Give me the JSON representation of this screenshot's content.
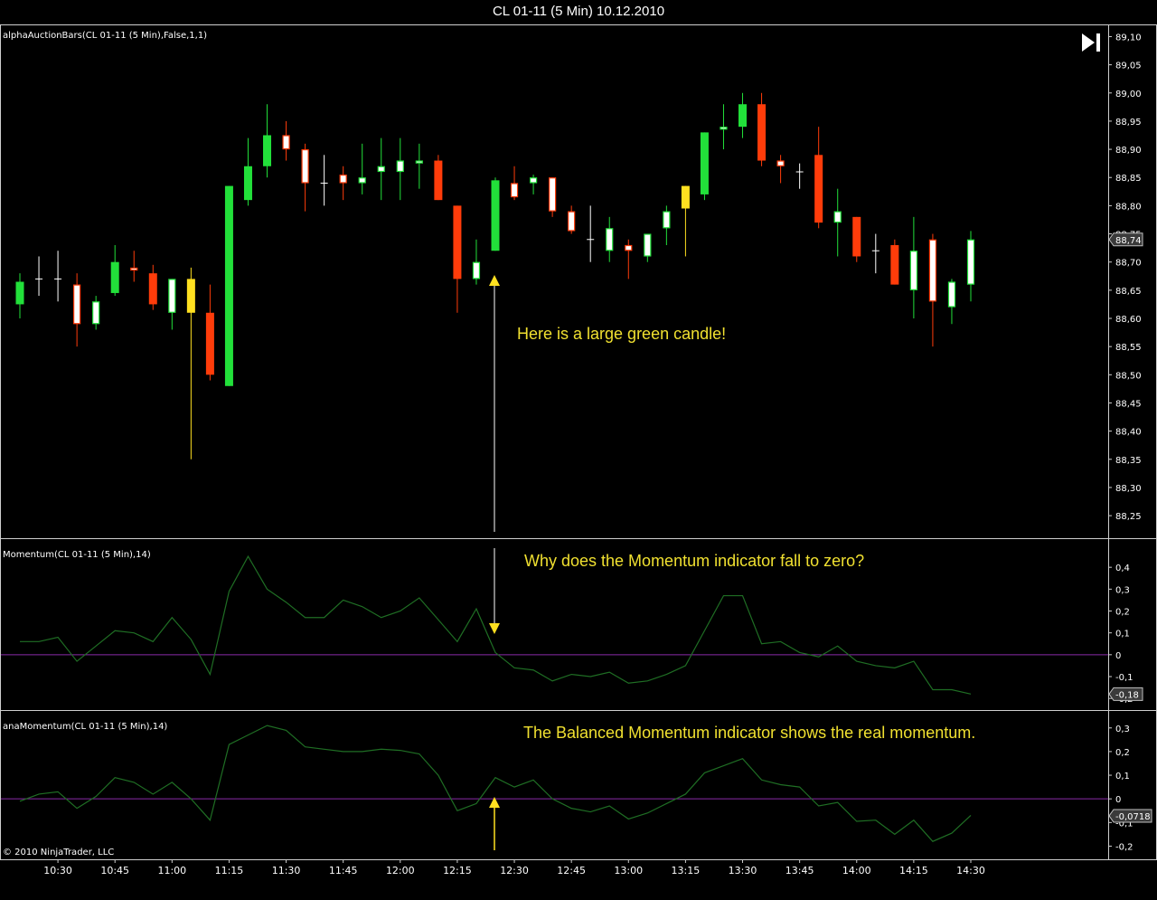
{
  "window": {
    "title": "CL 01-11 (5 Min)  10.12.2010"
  },
  "copyright": "© 2010 NinjaTrader, LLC",
  "colors": {
    "background": "#000000",
    "bull": "#22e03a",
    "bear": "#ff3c0a",
    "neutral_body": "#ffffff",
    "neutral_wick": "#ffffff",
    "yellow": "#ffe020",
    "indicator_line": "#1f6e24",
    "zero_line": "#8a2aa8",
    "annotation_text": "#f0e030",
    "grid_border": "#cfcfcf"
  },
  "icons": {
    "jump_to_end": "skip-to-end-icon"
  },
  "chart_data": [
    {
      "type": "candlestick",
      "label": "alphaAuctionBars(CL 01-11 (5 Min),False,1,1)",
      "ylim": [
        88.21,
        89.12
      ],
      "ytick_labels": [
        "89,10",
        "89,05",
        "89,00",
        "88,95",
        "88,90",
        "88,85",
        "88,80",
        "88,75",
        "88,70",
        "88,65",
        "88,60",
        "88,55",
        "88,50",
        "88,45",
        "88,40",
        "88,35",
        "88,30",
        "88,25"
      ],
      "ytick_values": [
        89.1,
        89.05,
        89.0,
        88.95,
        88.9,
        88.85,
        88.8,
        88.75,
        88.7,
        88.65,
        88.6,
        88.55,
        88.5,
        88.45,
        88.4,
        88.35,
        88.3,
        88.25
      ],
      "last_value_label": "88,74",
      "last_value": 88.74,
      "annotation": "Here is a large green candle!",
      "bars": [
        {
          "o": 88.625,
          "h": 88.68,
          "l": 88.6,
          "c": 88.665,
          "s": "bull",
          "f": true
        },
        {
          "o": 88.67,
          "h": 88.71,
          "l": 88.64,
          "c": 88.67,
          "s": "doji",
          "f": true
        },
        {
          "o": 88.67,
          "h": 88.72,
          "l": 88.63,
          "c": 88.67,
          "s": "doji",
          "f": true
        },
        {
          "o": 88.66,
          "h": 88.68,
          "l": 88.55,
          "c": 88.59,
          "s": "bear",
          "f": false
        },
        {
          "o": 88.59,
          "h": 88.64,
          "l": 88.58,
          "c": 88.63,
          "s": "bull",
          "f": false
        },
        {
          "o": 88.645,
          "h": 88.73,
          "l": 88.64,
          "c": 88.7,
          "s": "bull",
          "f": true
        },
        {
          "o": 88.69,
          "h": 88.72,
          "l": 88.665,
          "c": 88.685,
          "s": "bear",
          "f": false
        },
        {
          "o": 88.68,
          "h": 88.695,
          "l": 88.615,
          "c": 88.625,
          "s": "bear",
          "f": true
        },
        {
          "o": 88.61,
          "h": 88.67,
          "l": 88.58,
          "c": 88.67,
          "s": "bull",
          "f": false
        },
        {
          "o": 88.67,
          "h": 88.69,
          "l": 88.35,
          "c": 88.61,
          "s": "yellow",
          "f": true
        },
        {
          "o": 88.61,
          "h": 88.66,
          "l": 88.49,
          "c": 88.5,
          "s": "bear",
          "f": true
        },
        {
          "o": 88.48,
          "h": 88.835,
          "l": 88.48,
          "c": 88.835,
          "s": "bull",
          "f": true
        },
        {
          "o": 88.81,
          "h": 88.92,
          "l": 88.8,
          "c": 88.87,
          "s": "bull",
          "f": true
        },
        {
          "o": 88.87,
          "h": 88.98,
          "l": 88.85,
          "c": 88.925,
          "s": "bull",
          "f": true
        },
        {
          "o": 88.925,
          "h": 88.95,
          "l": 88.88,
          "c": 88.9,
          "s": "bear",
          "f": false
        },
        {
          "o": 88.9,
          "h": 88.91,
          "l": 88.79,
          "c": 88.84,
          "s": "bear",
          "f": false
        },
        {
          "o": 88.84,
          "h": 88.89,
          "l": 88.8,
          "c": 88.84,
          "s": "doji",
          "f": true
        },
        {
          "o": 88.855,
          "h": 88.87,
          "l": 88.81,
          "c": 88.84,
          "s": "bear",
          "f": false
        },
        {
          "o": 88.84,
          "h": 88.91,
          "l": 88.82,
          "c": 88.85,
          "s": "bull",
          "f": false
        },
        {
          "o": 88.86,
          "h": 88.92,
          "l": 88.81,
          "c": 88.87,
          "s": "bull",
          "f": false
        },
        {
          "o": 88.86,
          "h": 88.92,
          "l": 88.81,
          "c": 88.88,
          "s": "bull",
          "f": false
        },
        {
          "o": 88.875,
          "h": 88.91,
          "l": 88.83,
          "c": 88.88,
          "s": "bull",
          "f": false
        },
        {
          "o": 88.88,
          "h": 88.89,
          "l": 88.81,
          "c": 88.81,
          "s": "bear",
          "f": true
        },
        {
          "o": 88.8,
          "h": 88.8,
          "l": 88.61,
          "c": 88.67,
          "s": "bear",
          "f": true
        },
        {
          "o": 88.67,
          "h": 88.74,
          "l": 88.66,
          "c": 88.7,
          "s": "bull",
          "f": false
        },
        {
          "o": 88.72,
          "h": 88.85,
          "l": 88.72,
          "c": 88.845,
          "s": "bull",
          "f": true
        },
        {
          "o": 88.84,
          "h": 88.87,
          "l": 88.81,
          "c": 88.815,
          "s": "bear",
          "f": false
        },
        {
          "o": 88.84,
          "h": 88.855,
          "l": 88.82,
          "c": 88.85,
          "s": "bull",
          "f": false
        },
        {
          "o": 88.85,
          "h": 88.85,
          "l": 88.78,
          "c": 88.79,
          "s": "bear",
          "f": false
        },
        {
          "o": 88.79,
          "h": 88.8,
          "l": 88.75,
          "c": 88.755,
          "s": "bear",
          "f": false
        },
        {
          "o": 88.74,
          "h": 88.8,
          "l": 88.7,
          "c": 88.74,
          "s": "doji",
          "f": true
        },
        {
          "o": 88.72,
          "h": 88.78,
          "l": 88.7,
          "c": 88.76,
          "s": "bull",
          "f": false
        },
        {
          "o": 88.73,
          "h": 88.74,
          "l": 88.67,
          "c": 88.72,
          "s": "bear",
          "f": false
        },
        {
          "o": 88.71,
          "h": 88.75,
          "l": 88.7,
          "c": 88.75,
          "s": "bull",
          "f": false
        },
        {
          "o": 88.76,
          "h": 88.8,
          "l": 88.73,
          "c": 88.79,
          "s": "bull",
          "f": false
        },
        {
          "o": 88.795,
          "h": 88.835,
          "l": 88.71,
          "c": 88.835,
          "s": "yellow",
          "f": true
        },
        {
          "o": 88.82,
          "h": 88.93,
          "l": 88.81,
          "c": 88.93,
          "s": "bull",
          "f": true
        },
        {
          "o": 88.935,
          "h": 88.98,
          "l": 88.9,
          "c": 88.94,
          "s": "bull",
          "f": false
        },
        {
          "o": 88.94,
          "h": 89.0,
          "l": 88.92,
          "c": 88.98,
          "s": "bull",
          "f": true
        },
        {
          "o": 88.98,
          "h": 89.0,
          "l": 88.87,
          "c": 88.88,
          "s": "bear",
          "f": true
        },
        {
          "o": 88.88,
          "h": 88.89,
          "l": 88.84,
          "c": 88.87,
          "s": "bear",
          "f": false
        },
        {
          "o": 88.86,
          "h": 88.875,
          "l": 88.83,
          "c": 88.86,
          "s": "doji",
          "f": true
        },
        {
          "o": 88.89,
          "h": 88.94,
          "l": 88.76,
          "c": 88.77,
          "s": "bear",
          "f": true
        },
        {
          "o": 88.77,
          "h": 88.83,
          "l": 88.71,
          "c": 88.79,
          "s": "bull",
          "f": false
        },
        {
          "o": 88.78,
          "h": 88.78,
          "l": 88.7,
          "c": 88.71,
          "s": "bear",
          "f": true
        },
        {
          "o": 88.72,
          "h": 88.75,
          "l": 88.68,
          "c": 88.72,
          "s": "doji",
          "f": true
        },
        {
          "o": 88.73,
          "h": 88.74,
          "l": 88.66,
          "c": 88.66,
          "s": "bear",
          "f": true
        },
        {
          "o": 88.65,
          "h": 88.78,
          "l": 88.6,
          "c": 88.72,
          "s": "bull",
          "f": false
        },
        {
          "o": 88.74,
          "h": 88.75,
          "l": 88.55,
          "c": 88.63,
          "s": "bear",
          "f": false
        },
        {
          "o": 88.62,
          "h": 88.67,
          "l": 88.59,
          "c": 88.665,
          "s": "bull",
          "f": false
        },
        {
          "o": 88.66,
          "h": 88.755,
          "l": 88.63,
          "c": 88.74,
          "s": "bull",
          "f": false
        }
      ]
    },
    {
      "type": "line",
      "label": "Momentum(CL 01-11 (5 Min),14)",
      "ylim": [
        -0.22,
        0.5
      ],
      "ytick_labels": [
        "0,4",
        "0,3",
        "0,2",
        "0,1",
        "0",
        "-0,1",
        "-0,2"
      ],
      "ytick_values": [
        0.4,
        0.3,
        0.2,
        0.1,
        0,
        -0.1,
        -0.2
      ],
      "last_value_label": "-0,18",
      "last_value": -0.18,
      "zero_line": 0,
      "annotation": "Why does the Momentum indicator fall to zero?",
      "values": [
        0.06,
        0.06,
        0.08,
        -0.03,
        0.04,
        0.11,
        0.1,
        0.06,
        0.17,
        0.07,
        -0.09,
        0.29,
        0.45,
        0.3,
        0.24,
        0.17,
        0.17,
        0.25,
        0.22,
        0.17,
        0.2,
        0.26,
        0.16,
        0.06,
        0.21,
        0.01,
        -0.06,
        -0.07,
        -0.12,
        -0.09,
        -0.1,
        -0.08,
        -0.13,
        -0.12,
        -0.09,
        -0.05,
        0.11,
        0.27,
        0.27,
        0.05,
        0.06,
        0.01,
        -0.01,
        0.04,
        -0.03,
        -0.05,
        -0.06,
        -0.03,
        -0.16,
        -0.16,
        -0.18
      ]
    },
    {
      "type": "line",
      "label": "anaMomentum(CL 01-11 (5 Min),14)",
      "ylim": [
        -0.225,
        0.345
      ],
      "ytick_labels": [
        "0,3",
        "0,2",
        "0,1",
        "0",
        "-0,1",
        "-0,2"
      ],
      "ytick_values": [
        0.3,
        0.2,
        0.1,
        0,
        -0.1,
        -0.2
      ],
      "last_value_label": "-0,0718",
      "last_value": -0.0718,
      "zero_line": 0,
      "annotation": "The Balanced Momentum indicator shows the real momentum.",
      "values": [
        -0.01,
        0.02,
        0.03,
        -0.04,
        0.01,
        0.09,
        0.07,
        0.02,
        0.07,
        0.0,
        -0.09,
        0.23,
        0.27,
        0.31,
        0.29,
        0.22,
        0.21,
        0.2,
        0.2,
        0.21,
        0.205,
        0.19,
        0.1,
        -0.05,
        -0.02,
        0.09,
        0.05,
        0.08,
        0.0,
        -0.04,
        -0.055,
        -0.03,
        -0.085,
        -0.06,
        -0.02,
        0.02,
        0.11,
        0.14,
        0.17,
        0.08,
        0.06,
        0.05,
        -0.03,
        -0.015,
        -0.095,
        -0.09,
        -0.15,
        -0.09,
        -0.18,
        -0.145,
        -0.07
      ]
    }
  ],
  "x_axis": {
    "tick_labels": [
      "10:30",
      "10:45",
      "11:00",
      "11:15",
      "11:30",
      "11:45",
      "12:00",
      "12:15",
      "12:30",
      "12:45",
      "13:00",
      "13:15",
      "13:30",
      "13:45",
      "14:00",
      "14:15",
      "14:30"
    ],
    "tick_bar_index": [
      2,
      5,
      8,
      11,
      14,
      17,
      20,
      23,
      26,
      29,
      32,
      35,
      38,
      41,
      44,
      47,
      50
    ]
  }
}
